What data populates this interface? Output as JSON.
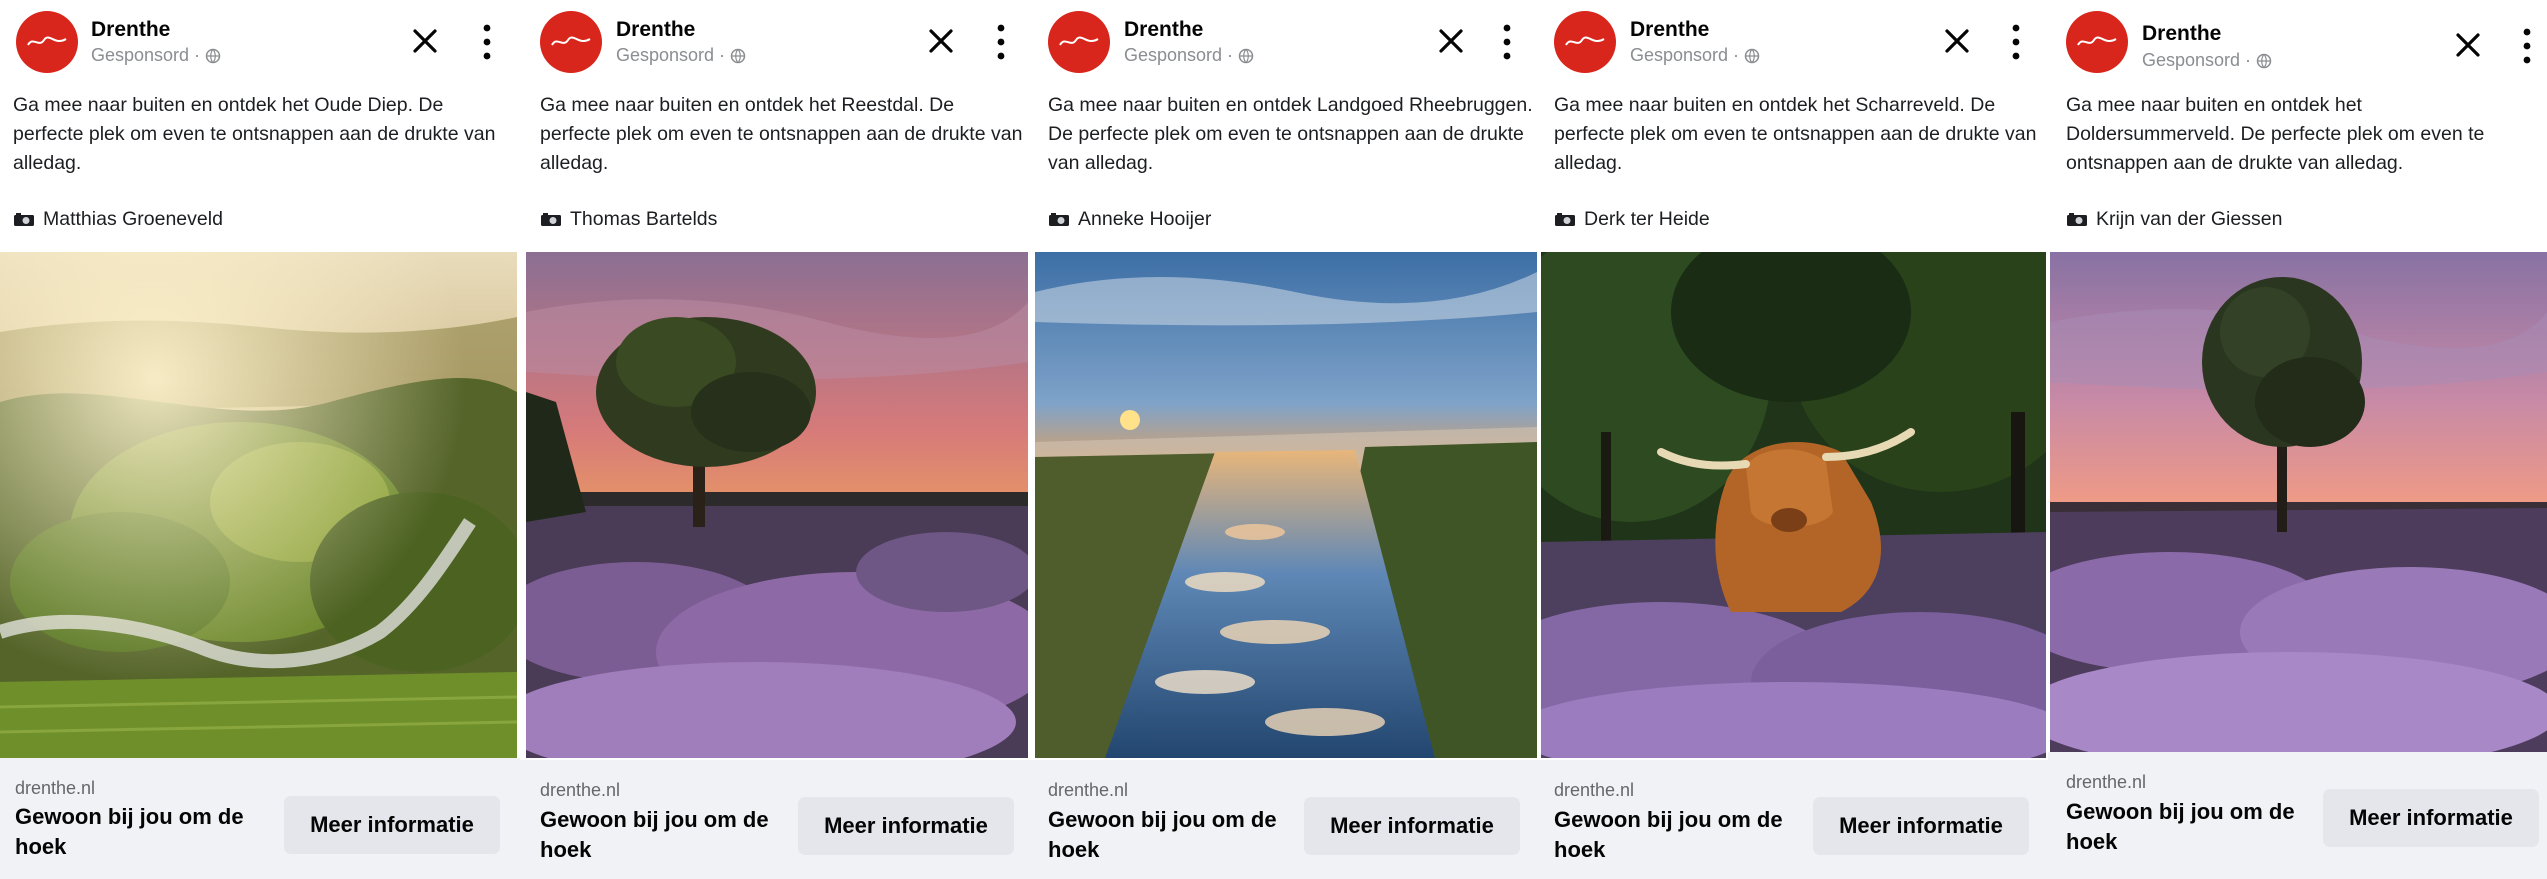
{
  "colors": {
    "brand": "#d9261c",
    "footer_bg": "#f0f2f5",
    "button_bg": "#e4e6eb",
    "muted_text": "#65676b"
  },
  "icons": {
    "close": "close-icon",
    "more": "more-options-icon",
    "audience": "globe-icon",
    "credit": "camera-icon",
    "logo": "drenthe-logo"
  },
  "ads": [
    {
      "page_name": "Drenthe",
      "sponsored": "Gesponsord ·",
      "body": "Ga mee naar buiten en ontdek het Oude Diep. De perfecte plek om even te ontsnappen aan de drukte van alledag.",
      "credit": "Matthias Groeneveld",
      "photo": "Misty sunrise over a forested river valley with a winding stream",
      "domain": "drenthe.nl",
      "headline": "Gewoon bij jou om de hoek",
      "cta": "Meer informatie"
    },
    {
      "page_name": "Drenthe",
      "sponsored": "Gesponsord ·",
      "body": "Ga mee naar buiten en ontdek het Reestdal. De perfecte plek om even te ontsnappen aan de drukte van alledag.",
      "credit": "Thomas Bartelds",
      "photo": "Lone oak tree on purple heathland under a pink sunset sky",
      "domain": "drenthe.nl",
      "headline": "Gewoon bij jou om de hoek",
      "cta": "Meer informatie"
    },
    {
      "page_name": "Drenthe",
      "sponsored": "Gesponsord ·",
      "body": "Ga mee naar buiten en ontdek Landgoed Rheebruggen. De perfecte plek om even te ontsnappen aan de drukte van alledag.",
      "credit": "Anneke Hooijer",
      "photo": "Sunrise reflected in a straight canal with clouds on the water",
      "domain": "drenthe.nl",
      "headline": "Gewoon bij jou om de hoek",
      "cta": "Meer informatie"
    },
    {
      "page_name": "Drenthe",
      "sponsored": "Gesponsord ·",
      "body": "Ga mee naar buiten en ontdek het Scharreveld. De perfecte plek om even te ontsnappen aan de drukte van alledag.",
      "credit": "Derk ter Heide",
      "photo": "Highland cow resting in blooming heather in front of trees",
      "domain": "drenthe.nl",
      "headline": "Gewoon bij jou om de hoek",
      "cta": "Meer informatie"
    },
    {
      "page_name": "Drenthe",
      "sponsored": "Gesponsord ·",
      "body": "Ga mee naar buiten en ontdek het Doldersummerveld. De perfecte plek om even te ontsnappen aan de drukte van alledag.",
      "credit": "Krijn van der Giessen",
      "photo": "Single tree on a heath covered in purple heather at dusk",
      "domain": "drenthe.nl",
      "headline": "Gewoon bij jou om de hoek",
      "cta": "Meer informatie"
    }
  ]
}
